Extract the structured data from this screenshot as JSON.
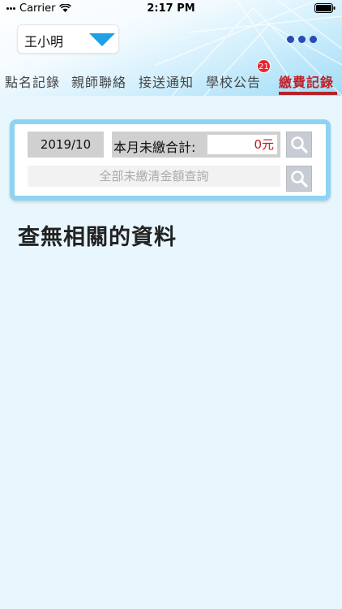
{
  "status_bar": {
    "carrier": "Carrier",
    "time": "2:17 PM"
  },
  "student_selector": {
    "value": "王小明"
  },
  "tabs": [
    {
      "label": "點名記錄",
      "active": false
    },
    {
      "label": "親師聯絡",
      "active": false
    },
    {
      "label": "接送通知",
      "active": false
    },
    {
      "label": "學校公告",
      "active": false,
      "badge": "21"
    },
    {
      "label": "繳費記錄",
      "active": true
    }
  ],
  "query": {
    "month": "2019/10",
    "unpaid_total_label": "本月未繳合計:",
    "unpaid_total_value": "0元",
    "full_query_label": "全部未繳清金額查詢"
  },
  "result": {
    "empty_message": "查無相關的資料"
  },
  "colors": {
    "accent": "#b3232b",
    "panel_border": "#8fd3f3",
    "dots": "#2a4bb5",
    "badge": "#e8242b"
  }
}
